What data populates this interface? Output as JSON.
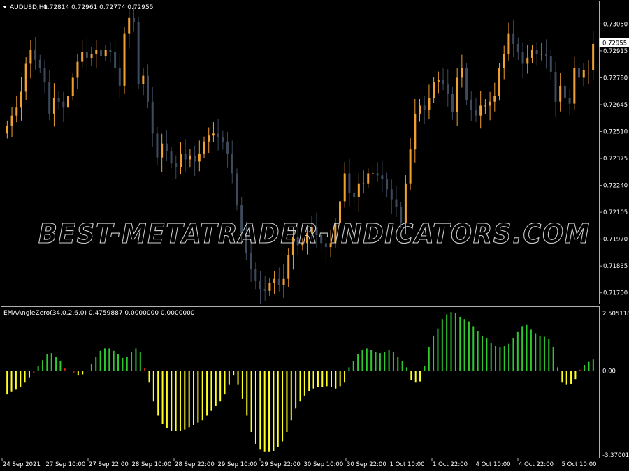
{
  "main_header": {
    "symbol": "AUDUSD,H1",
    "ohlc": "0.72814 0.72961 0.72774 0.72955"
  },
  "current_price": "0.72955",
  "indicator_header": {
    "name": "EMAAngleZero(34,0.2,6,0) 0.4759887 0.0000000 0.0000000"
  },
  "watermark": "BEST-METATRADER-INDICATORS.COM",
  "colors": {
    "background": "#000000",
    "bull_candle": "#f0a030",
    "bear_candle": "#3d4a5c",
    "indicator_up": "#2fc82f",
    "indicator_down": "#ffff20",
    "indicator_flat": "#d02020",
    "frame": "#b0b0b0",
    "price_line": "#7f8fa6"
  },
  "price_axis_labels": [
    "0.73050",
    "0.72915",
    "0.72780",
    "0.72645",
    "0.72510",
    "0.72375",
    "0.72240",
    "0.72105",
    "0.71970",
    "0.71835",
    "0.71700"
  ],
  "indicator_axis_labels": [
    "2.5051184",
    "0.00",
    "-3.3700112"
  ],
  "time_axis_labels": [
    "24 Sep 2021",
    "27 Sep 10:00",
    "27 Sep 22:00",
    "28 Sep 10:00",
    "28 Sep 22:00",
    "29 Sep 10:00",
    "29 Sep 22:00",
    "30 Sep 10:00",
    "30 Sep 22:00",
    "1 Oct 10:00",
    "1 Oct 22:00",
    "4 Oct 10:00",
    "4 Oct 22:00",
    "5 Oct 10:00"
  ],
  "chart_data": [
    {
      "type": "candlestick",
      "title": "AUDUSD,H1",
      "ylim": [
        0.7165,
        0.7316
      ],
      "close": [
        0.7254,
        0.7259,
        0.7263,
        0.7271,
        0.7285,
        0.7292,
        0.7287,
        0.7283,
        0.7276,
        0.726,
        0.7268,
        0.7266,
        0.7263,
        0.7269,
        0.7278,
        0.7286,
        0.7291,
        0.7288,
        0.729,
        0.7292,
        0.7289,
        0.7292,
        0.7291,
        0.7283,
        0.7274,
        0.73,
        0.7308,
        0.7306,
        0.7275,
        0.7279,
        0.7266,
        0.725,
        0.7238,
        0.7245,
        0.7241,
        0.7235,
        0.7233,
        0.724,
        0.7237,
        0.7239,
        0.7236,
        0.724,
        0.7246,
        0.7249,
        0.725,
        0.7248,
        0.7246,
        0.724,
        0.723,
        0.7214,
        0.72,
        0.719,
        0.7182,
        0.7176,
        0.7172,
        0.7171,
        0.7175,
        0.7177,
        0.7174,
        0.7177,
        0.7189,
        0.7198,
        0.7194,
        0.7195,
        0.72,
        0.7203,
        0.7199,
        0.7195,
        0.7193,
        0.7195,
        0.7205,
        0.7216,
        0.723,
        0.722,
        0.7218,
        0.7225,
        0.7225,
        0.723,
        0.723,
        0.7229,
        0.7227,
        0.7222,
        0.7217,
        0.7213,
        0.7205,
        0.7225,
        0.7242,
        0.726,
        0.7264,
        0.7262,
        0.7268,
        0.7276,
        0.7277,
        0.7275,
        0.727,
        0.7261,
        0.7278,
        0.7283,
        0.7267,
        0.7262,
        0.7259,
        0.7264,
        0.7264,
        0.7266,
        0.7269,
        0.7283,
        0.729,
        0.73,
        0.7295,
        0.7291,
        0.7285,
        0.7288,
        0.7292,
        0.729,
        0.729,
        0.7289,
        0.7281,
        0.7266,
        0.7274,
        0.7268,
        0.7265,
        0.7283,
        0.7278,
        0.7282,
        0.7282,
        0.7295
      ]
    },
    {
      "type": "bar",
      "title": "EMAAngleZero(34,0.2,6,0)",
      "ylim": [
        -3.3700112,
        2.5051184
      ],
      "values": [
        -1.0,
        -0.9,
        -0.8,
        -0.7,
        -0.5,
        -0.3,
        -0.1,
        0.2,
        0.45,
        0.7,
        0.75,
        0.6,
        0.4,
        0.1,
        0.0,
        -0.1,
        -0.2,
        -0.15,
        0.0,
        0.3,
        0.6,
        0.85,
        0.95,
        0.95,
        0.85,
        0.7,
        0.55,
        0.6,
        0.8,
        0.95,
        0.8,
        0.1,
        -0.5,
        -1.3,
        -1.9,
        -2.25,
        -2.45,
        -2.55,
        -2.55,
        -2.55,
        -2.5,
        -2.4,
        -2.3,
        -2.2,
        -2.1,
        -1.9,
        -1.7,
        -1.5,
        -1.3,
        -1.0,
        -0.6,
        -0.2,
        -0.6,
        -1.2,
        -1.9,
        -2.6,
        -3.1,
        -3.35,
        -3.45,
        -3.45,
        -3.4,
        -3.25,
        -3.0,
        -2.6,
        -2.1,
        -1.6,
        -1.3,
        -1.05,
        -0.85,
        -0.75,
        -0.7,
        -0.7,
        -0.65,
        -0.7,
        -0.75,
        -0.65,
        -0.5,
        0.15,
        0.4,
        0.7,
        0.9,
        0.95,
        0.9,
        0.8,
        0.75,
        0.8,
        0.9,
        0.8,
        0.6,
        0.4,
        0.15,
        -0.4,
        -0.5,
        -0.45,
        0.2,
        1.0,
        1.5,
        1.8,
        2.2,
        2.4,
        2.5,
        2.45,
        2.3,
        2.2,
        2.1,
        1.9,
        1.7,
        1.5,
        1.4,
        1.2,
        1.05,
        1.0,
        1.05,
        1.15,
        1.4,
        1.65,
        1.9,
        1.95,
        1.75,
        1.6,
        1.5,
        1.45,
        1.35,
        1.0,
        0.15,
        -0.5,
        -0.6,
        -0.55,
        -0.35,
        0.05,
        0.25,
        0.38,
        0.48
      ]
    }
  ]
}
